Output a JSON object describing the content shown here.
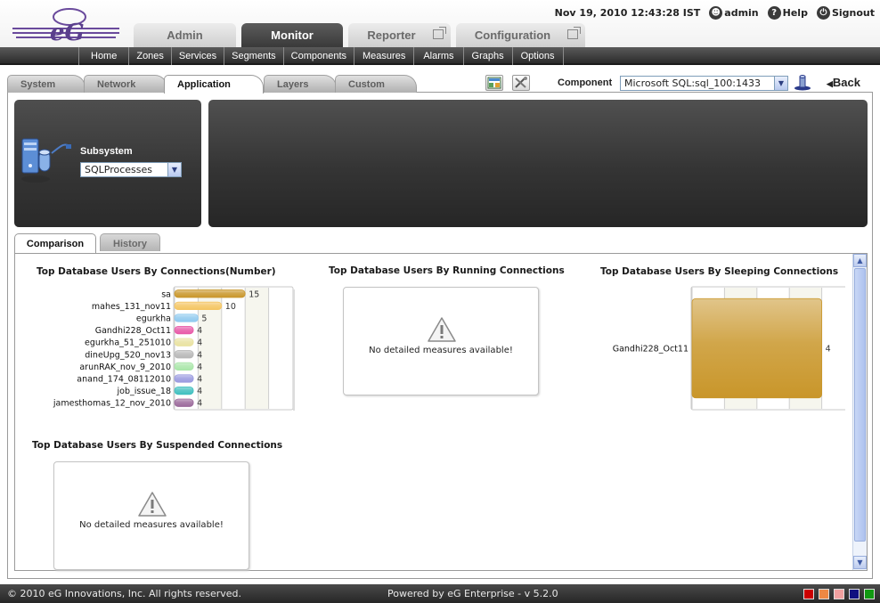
{
  "header": {
    "datetime": "Nov 19, 2010 12:43:28 IST",
    "user": "admin",
    "help": "Help",
    "signout": "Signout",
    "logo_text": "eG"
  },
  "main_tabs": [
    {
      "label": "Admin",
      "active": false
    },
    {
      "label": "Monitor",
      "active": true
    },
    {
      "label": "Reporter",
      "active": false
    },
    {
      "label": "Configuration",
      "active": false
    }
  ],
  "subnav": [
    "Home",
    "Zones",
    "Services",
    "Segments",
    "Components",
    "Measures",
    "Alarms",
    "Graphs",
    "Options"
  ],
  "layer_tabs": [
    {
      "label": "System",
      "active": false
    },
    {
      "label": "Network",
      "active": false
    },
    {
      "label": "Application",
      "active": true
    },
    {
      "label": "Layers",
      "active": false
    },
    {
      "label": "Custom",
      "active": false
    }
  ],
  "component": {
    "label": "Component",
    "value": "Microsoft SQL:sql_100:1433"
  },
  "back_label": "Back",
  "subsystem": {
    "label": "Subsystem",
    "value": "SQLProcesses"
  },
  "view_tabs": [
    {
      "label": "Comparison",
      "active": true
    },
    {
      "label": "History",
      "active": false
    }
  ],
  "charts": {
    "connections": {
      "title": "Top Database Users By Connections(Number)"
    },
    "running": {
      "title": "Top Database Users By Running Connections",
      "message": "No detailed measures available!"
    },
    "sleeping": {
      "title": "Top Database Users By Sleeping Connections"
    },
    "suspended": {
      "title": "Top Database Users By Suspended Connections",
      "message": "No detailed measures available!"
    }
  },
  "chart_data": [
    {
      "type": "bar",
      "orientation": "horizontal",
      "title": "Top Database Users By Connections(Number)",
      "categories": [
        "sa",
        "mahes_131_nov11",
        "egurkha",
        "Gandhi228_Oct11",
        "egurkha_51_251010",
        "dineUpg_520_nov13",
        "arunRAK_nov_9_2010",
        "anand_174_08112010",
        "job_issue_18",
        "jamesthomas_12_nov_2010"
      ],
      "values": [
        15,
        10,
        5,
        4,
        4,
        4,
        4,
        4,
        4,
        4
      ],
      "colors": [
        "#c9962a",
        "#f4c563",
        "#8fc9ef",
        "#e85aa8",
        "#e9e2a0",
        "#b7b7b7",
        "#a9e6a9",
        "#9a9ae0",
        "#3fbfbf",
        "#9b6a9b"
      ],
      "xlim": [
        0,
        25
      ],
      "grid": true
    },
    {
      "type": "bar",
      "orientation": "horizontal",
      "title": "Top Database Users By Sleeping Connections",
      "categories": [
        "Gandhi228_Oct11"
      ],
      "values": [
        4
      ],
      "colors": [
        "#c9962a"
      ],
      "xlim": [
        0,
        5
      ],
      "grid": true
    }
  ],
  "footer": {
    "copyright": "© 2010 eG Innovations, Inc. All rights reserved.",
    "powered": "Powered by eG Enterprise  - v 5.2.0",
    "swatches": [
      "#cc0000",
      "#ee8844",
      "#f0a0a0",
      "#101080",
      "#119911"
    ]
  }
}
